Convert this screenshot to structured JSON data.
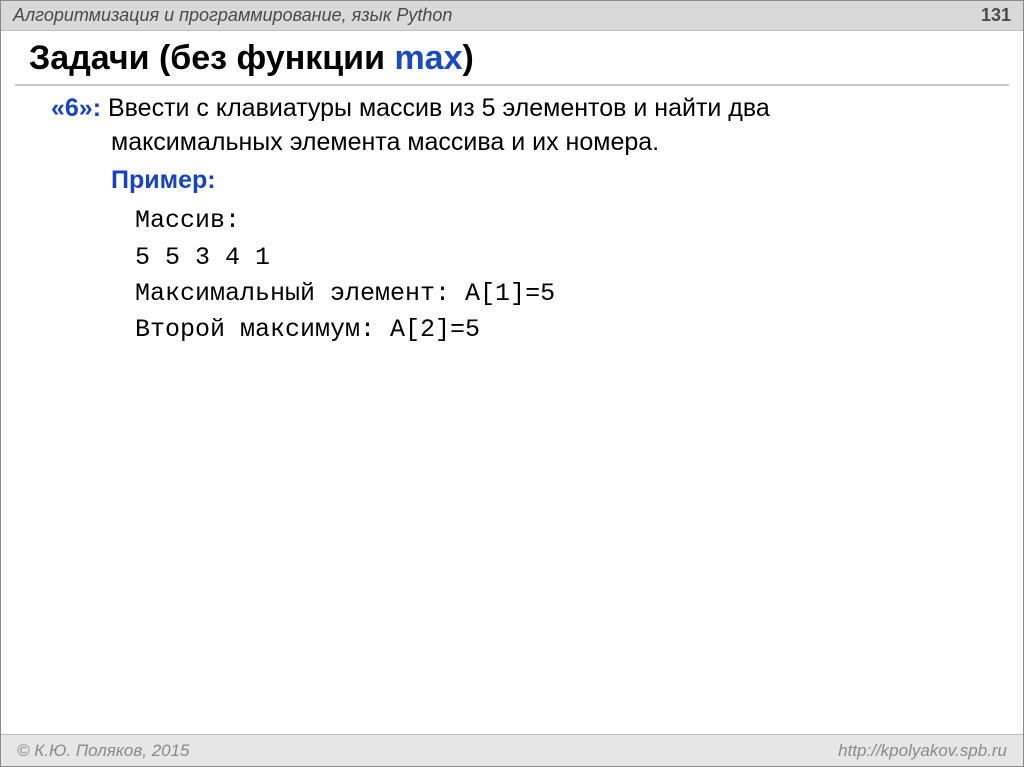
{
  "header": {
    "title": "Алгоритмизация и программирование, язык Python",
    "page_number": "131"
  },
  "title": {
    "prefix": "Задачи (без функции ",
    "keyword": "max",
    "suffix": ")"
  },
  "task": {
    "level_label": "«6»:",
    "line1": " Ввести с клавиатуры массив из 5 элементов и найти два",
    "line2": "максимальных элемента массива и их номера.",
    "example_label": "Пример:"
  },
  "code": {
    "l1": "Массив:",
    "l2": "5 5 3 4 1",
    "l3": "Максимальный элемент: A[1]=5",
    "l4": "Второй максимум: A[2]=5"
  },
  "footer": {
    "copyright": "© К.Ю. Поляков, 2015",
    "url": "http://kpolyakov.spb.ru"
  }
}
